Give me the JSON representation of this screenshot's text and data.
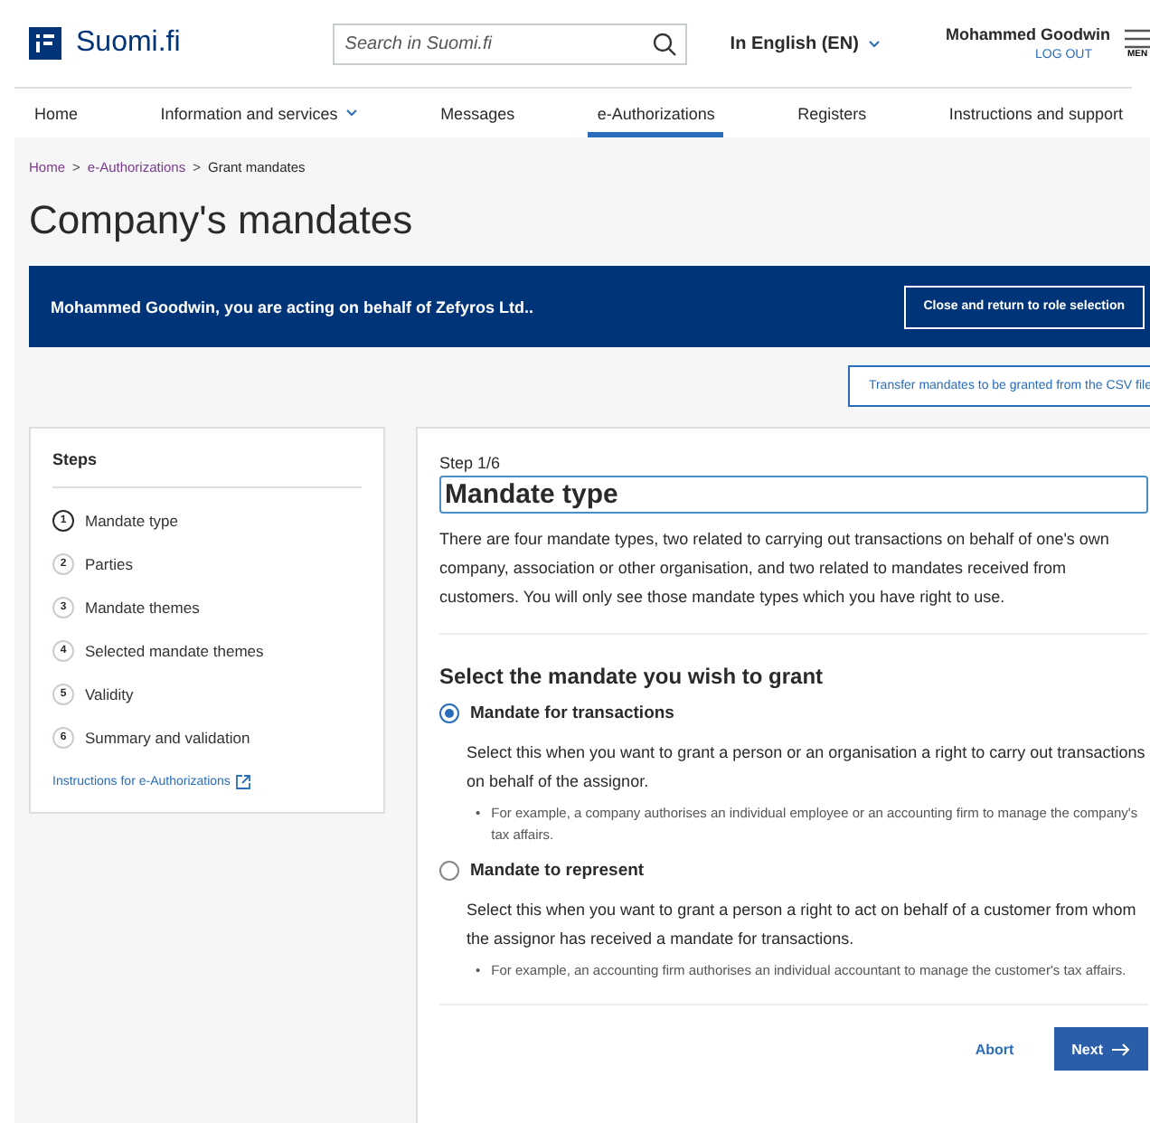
{
  "header": {
    "logo": "Suomi.fi",
    "search": {
      "placeholder": "Search in Suomi.fi"
    },
    "language": "In English (EN)",
    "user": "Mohammed Goodwin",
    "logout": "LOG OUT",
    "menu": "MEN"
  },
  "nav": [
    {
      "label": "Home",
      "selected": false,
      "dropdown": false
    },
    {
      "label": "Information and services",
      "selected": false,
      "dropdown": true
    },
    {
      "label": "Messages",
      "selected": false,
      "dropdown": false
    },
    {
      "label": "e-Authorizations",
      "selected": true,
      "dropdown": false
    },
    {
      "label": "Registers",
      "selected": false,
      "dropdown": false
    },
    {
      "label": "Instructions and support",
      "selected": false,
      "dropdown": false
    }
  ],
  "breadcrumb": [
    {
      "label": "Home",
      "link": true
    },
    {
      "separator": ">",
      "label": "e-Authorizations",
      "link": true
    },
    {
      "separator": ">",
      "label": "Grant mandates",
      "link": false
    }
  ],
  "page_title": "Company's mandates",
  "banner": {
    "text": "Mohammed Goodwin, you are acting on behalf of Zefyros Ltd..",
    "button": "Close and return to role selection"
  },
  "csv_button": "Transfer mandates to be granted from the CSV file",
  "steps": {
    "title": "Steps",
    "items": [
      {
        "number": "1",
        "label": "Mandate type",
        "selected": true
      },
      {
        "number": "2",
        "label": "Parties",
        "selected": false
      },
      {
        "number": "3",
        "label": "Mandate themes",
        "selected": false
      },
      {
        "number": "4",
        "label": "Selected mandate themes",
        "selected": false
      },
      {
        "number": "5",
        "label": "Validity",
        "selected": false
      },
      {
        "number": "6",
        "label": "Summary and validation",
        "selected": false
      }
    ],
    "link": "Instructions for e-Authorizations"
  },
  "form": {
    "step": "Step 1/6",
    "title": "Mandate type",
    "intro": "There are four mandate types, two related to carrying out transactions on behalf of one's own company, association or other organisation, and two related to mandates received from customers. You will only see those mandate types which you have right to use.",
    "question": "Select the mandate you wish to grant",
    "options": [
      {
        "label": "Mandate for transactions",
        "selected": true,
        "description": "Select this when you want to grant a person or an organisation a right to carry out transactions on behalf of the assignor.",
        "bullet": "•",
        "example": "For example, a company authorises an individual employee or an accounting firm to manage the company's tax affairs."
      },
      {
        "label": "Mandate to represent",
        "selected": false,
        "description": "Select this when you want to grant a person a right to act on behalf of a customer from whom the assignor has received a mandate for transactions.",
        "bullet": "•",
        "example": "For example, an accounting firm authorises an individual accountant to manage the customer's tax affairs."
      }
    ],
    "abort": "Abort",
    "next": "Next"
  }
}
